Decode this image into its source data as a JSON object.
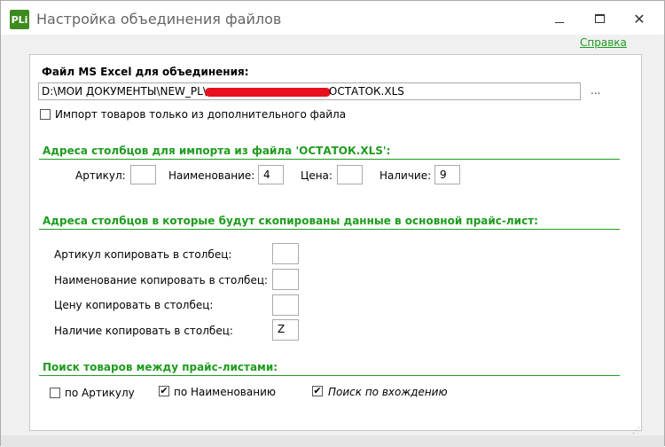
{
  "window": {
    "app_icon": "PLi",
    "title": "Настройка объединения файлов"
  },
  "help_link": "Справка",
  "file": {
    "label": "Файл MS Excel для объединения:",
    "path_prefix": "D:\\МОИ ДОКУМЕНТЫ\\NEW_PL\\",
    "path_suffix": "ОСТАТОК.XLS",
    "browse": "...",
    "import_only_label": "Импорт товаров только из дополнительного файла",
    "import_only_checked": false
  },
  "import_section": {
    "title": "Адреса столбцов для импорта из файла 'ОСТАТОК.XLS':",
    "articul_label": "Артикул:",
    "articul_value": "",
    "name_label": "Наименование:",
    "name_value": "4",
    "price_label": "Цена:",
    "price_value": "",
    "avail_label": "Наличие:",
    "avail_value": "9"
  },
  "copy_section": {
    "title": "Адреса столбцов в которые будут скопированы данные в основной прайс-лист:",
    "rows": [
      {
        "label": "Артикул копировать в столбец:",
        "value": ""
      },
      {
        "label": "Наименование копировать в столбец:",
        "value": ""
      },
      {
        "label": "Цену копировать в столбец:",
        "value": ""
      },
      {
        "label": "Наличие копировать в столбец:",
        "value": "Z"
      }
    ]
  },
  "search_section": {
    "title": "Поиск товаров между прайс-листами:",
    "by_articul_label": "по Артикулу",
    "by_articul_checked": false,
    "by_name_label": "по Наименованию",
    "by_name_checked": true,
    "substring_label": "Поиск по вхождению",
    "substring_checked": true
  }
}
